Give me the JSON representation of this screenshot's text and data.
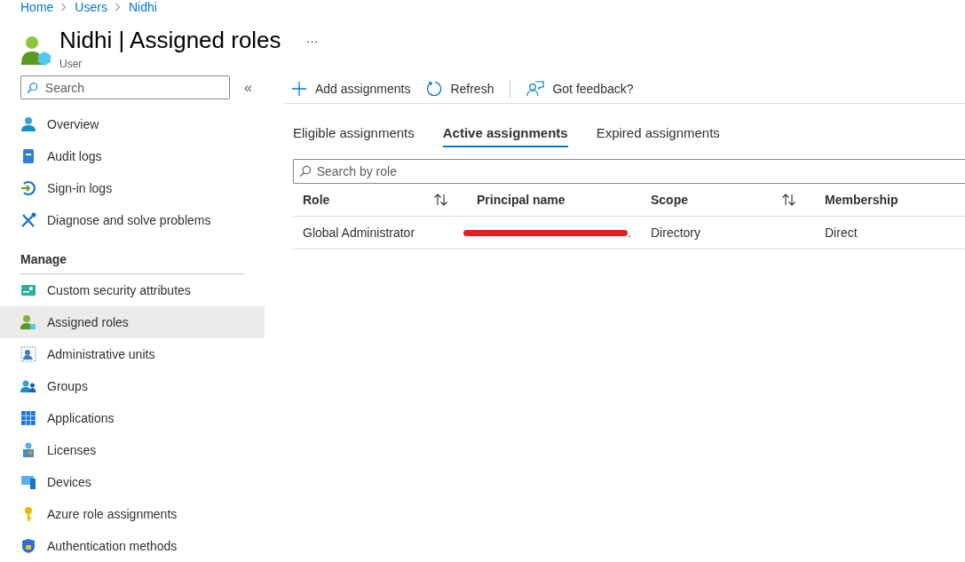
{
  "breadcrumb": [
    "Home",
    "Users",
    "Nidhi"
  ],
  "header": {
    "name": "Nidhi",
    "separator": "|",
    "title": "Assigned roles",
    "subtitle": "User",
    "more": "···"
  },
  "sidebar": {
    "search": {
      "placeholder": "Search"
    },
    "collapse": "«",
    "items": [
      {
        "label": "Overview",
        "selected": false
      },
      {
        "label": "Audit logs",
        "selected": false
      },
      {
        "label": "Sign-in logs",
        "selected": false
      },
      {
        "label": "Diagnose and solve problems",
        "selected": false
      }
    ],
    "section": "Manage",
    "manage_items": [
      {
        "label": "Custom security attributes",
        "selected": false
      },
      {
        "label": "Assigned roles",
        "selected": true
      },
      {
        "label": "Administrative units",
        "selected": false
      },
      {
        "label": "Groups",
        "selected": false
      },
      {
        "label": "Applications",
        "selected": false
      },
      {
        "label": "Licenses",
        "selected": false
      },
      {
        "label": "Devices",
        "selected": false
      },
      {
        "label": "Azure role assignments",
        "selected": false
      },
      {
        "label": "Authentication methods",
        "selected": false
      }
    ]
  },
  "toolbar": [
    {
      "kind": "add",
      "label": "Add assignments"
    },
    {
      "kind": "refresh",
      "label": "Refresh"
    },
    {
      "kind": "feedback",
      "label": "Got feedback?"
    }
  ],
  "tabs": [
    {
      "label": "Eligible assignments",
      "selected": false
    },
    {
      "label": "Active assignments",
      "selected": true
    },
    {
      "label": "Expired assignments",
      "selected": false
    }
  ],
  "search": {
    "placeholder": "Search by role"
  },
  "table": {
    "columns": [
      {
        "label": "Role",
        "sortable": true
      },
      {
        "label": "Principal name",
        "sortable": false
      },
      {
        "label": "Scope",
        "sortable": true
      },
      {
        "label": "Membership",
        "sortable": false
      }
    ],
    "rows": [
      {
        "role": "Global Administrator",
        "principal": ".",
        "principal_redacted": true,
        "scope": "Directory",
        "membership": "Direct"
      }
    ]
  }
}
